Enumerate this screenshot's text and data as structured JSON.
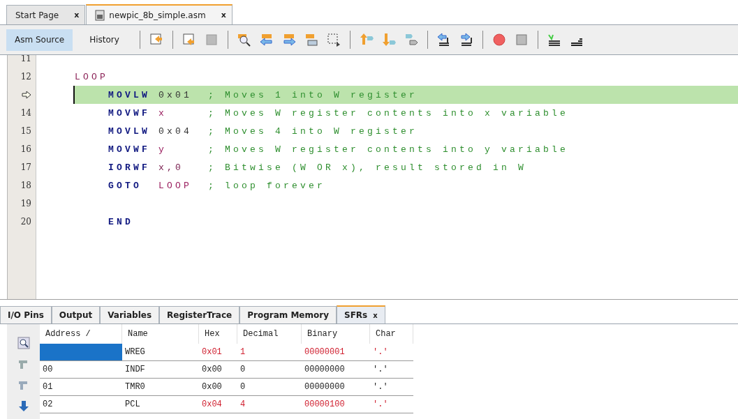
{
  "file_tabs": [
    {
      "label": "Start Page",
      "close": "x",
      "selected": false,
      "kind": "page"
    },
    {
      "label": "newpic_8b_simple.asm",
      "close": "x",
      "selected": true,
      "kind": "file"
    }
  ],
  "view_tabs": [
    {
      "label": "Asm Source",
      "selected": true
    },
    {
      "label": "History",
      "selected": false
    }
  ],
  "editor": {
    "lines": [
      {
        "number": "11",
        "current": false
      },
      {
        "number": "12",
        "current": false,
        "label": "LOOP"
      },
      {
        "current": true,
        "op": "MOVLW",
        "operand": {
          "text": "0x01",
          "kind": "number"
        },
        "comment": "; Moves 1 into W register"
      },
      {
        "number": "14",
        "current": false,
        "op": "MOVWF",
        "operand": {
          "text": "x",
          "kind": "symbol"
        },
        "comment": "; Moves W register contents into x variable"
      },
      {
        "number": "15",
        "current": false,
        "op": "MOVLW",
        "operand": {
          "text": "0x04",
          "kind": "number"
        },
        "comment": "; Moves 4 into W register"
      },
      {
        "number": "16",
        "current": false,
        "op": "MOVWF",
        "operand": {
          "text": "y",
          "kind": "symbol"
        },
        "comment": "; Moves W register contents into y variable"
      },
      {
        "number": "17",
        "current": false,
        "op": "IORWF",
        "operand": {
          "text": "x,0",
          "kind": "mixed"
        },
        "comment": "; Bitwise (W OR x), result stored in W"
      },
      {
        "number": "18",
        "current": false,
        "op": "GOTO",
        "operand": {
          "text": "LOOP",
          "kind": "symbol"
        },
        "comment": "; loop forever"
      },
      {
        "number": "19",
        "current": false
      },
      {
        "number": "20",
        "current": false,
        "op": "END"
      }
    ]
  },
  "panel_tabs": [
    {
      "label": "I/O Pins",
      "selected": false
    },
    {
      "label": "Output",
      "selected": false
    },
    {
      "label": "Variables",
      "selected": false
    },
    {
      "label": "RegisterTrace",
      "selected": false
    },
    {
      "label": "Program Memory",
      "selected": false
    },
    {
      "label": "SFRs",
      "selected": true,
      "close": "x"
    }
  ],
  "sfr_table": {
    "columns": [
      "Address  /",
      "Name",
      "Hex",
      "Decimal",
      "Binary",
      "Char"
    ],
    "rows": [
      {
        "name": "WREG",
        "hex": "0x01",
        "decimal": "1",
        "binary": "00000001",
        "char": "'.'",
        "changed": true,
        "selected": true
      },
      {
        "address": "00",
        "name": "INDF",
        "hex": "0x00",
        "decimal": "0",
        "binary": "00000000",
        "char": "'.'",
        "changed": false,
        "selected": false
      },
      {
        "address": "01",
        "name": "TMR0",
        "hex": "0x00",
        "decimal": "0",
        "binary": "00000000",
        "char": "'.'",
        "changed": false,
        "selected": false
      },
      {
        "address": "02",
        "name": "PCL",
        "hex": "0x04",
        "decimal": "4",
        "binary": "00000100",
        "char": "'.'",
        "changed": true,
        "selected": false
      }
    ]
  }
}
